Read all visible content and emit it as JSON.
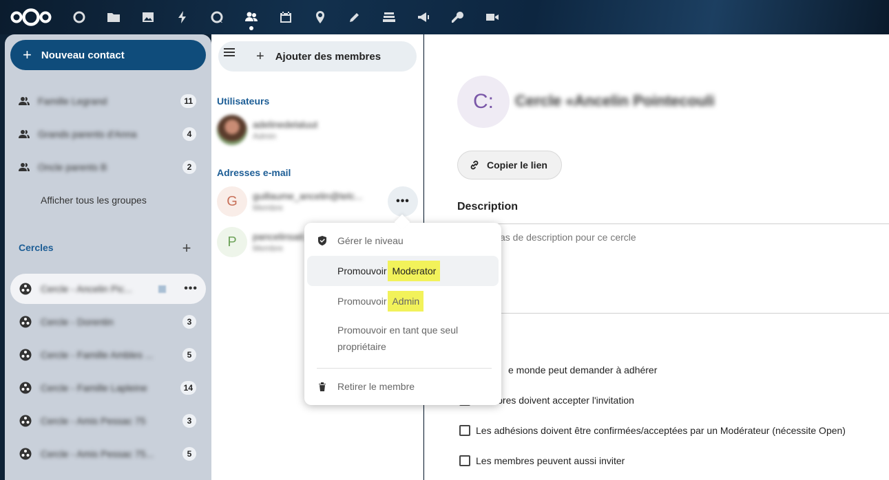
{
  "topbar": {
    "apps": [
      "dashboard-icon",
      "files-icon",
      "photos-icon",
      "activity-icon",
      "talk-icon",
      "contacts-icon",
      "calendar-icon",
      "maps-icon",
      "notes-icon",
      "deck-icon",
      "announcements-icon",
      "passwords-icon",
      "video-icon"
    ],
    "active_app": "contacts-icon"
  },
  "leftnav": {
    "new_contact_label": "Nouveau contact",
    "groups": [
      {
        "name": "Famille Legrand",
        "count": "11"
      },
      {
        "name": "Grands parents d'Anna",
        "count": "4"
      },
      {
        "name": "Oncle parents B",
        "count": "2"
      }
    ],
    "show_all_groups": "Afficher tous les groupes",
    "circles_title": "Cercles",
    "circles": [
      {
        "name": "Cercle - Ancelin Pic...",
        "count": ""
      },
      {
        "name": "Cercle - Dorentin",
        "count": "3"
      },
      {
        "name": "Cercle - Famille Ambles ...",
        "count": "5"
      },
      {
        "name": "Cercle - Famille Lapleine",
        "count": "14"
      },
      {
        "name": "Cercle - Amis Pessac 75",
        "count": "3"
      },
      {
        "name": "Cercle - Amis Pessac 75...",
        "count": "5"
      }
    ]
  },
  "middle": {
    "add_members_label": "Ajouter des membres",
    "users_caption": "Utilisateurs",
    "users": [
      {
        "line1": "adelinedelaluut",
        "line2": "Admin"
      }
    ],
    "emails_caption": "Adresses e-mail",
    "emails": [
      {
        "letter": "G",
        "line1": "guillaume_ancelin@telc...",
        "line2": "Membre"
      },
      {
        "letter": "P",
        "line1": "pancelinsait...",
        "line2": "Membre"
      }
    ]
  },
  "menu": {
    "manage_level": "Gérer le niveau",
    "promote_moderator_prefix": "Promouvoir ",
    "promote_moderator_role": "Moderator",
    "promote_admin_prefix": "Promouvoir ",
    "promote_admin_role": "Admin",
    "promote_owner": "Promouvoir en tant que seul propriétaire",
    "remove_member": "Retirer le membre"
  },
  "detail": {
    "avatar_letter": "C:",
    "title": "Cercle «Ancelin Pointecouli",
    "copy_link_label": "Copier le lien",
    "description_title": "Description",
    "description_placeholder": "as de description pour ce cercle",
    "options": [
      "e monde peut demander à adhérer",
      "...embres doivent accepter l'invitation",
      "Les adhésions doivent être confirmées/acceptées par un Modérateur (nécessite Open)",
      "Les membres peuvent aussi inviter"
    ]
  }
}
